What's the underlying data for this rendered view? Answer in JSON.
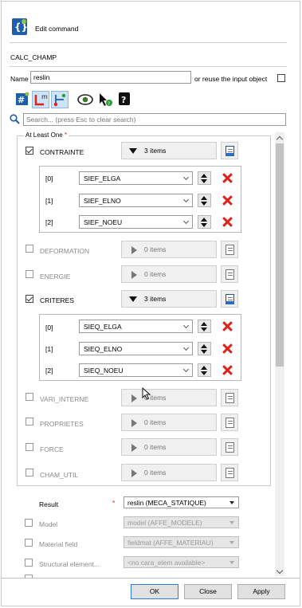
{
  "header": {
    "title": "Edit command",
    "command_name": "CALC_CHAMP"
  },
  "name_row": {
    "label": "Name",
    "value": "reslin",
    "reuse_label": "or reuse the input object"
  },
  "toolbar": {
    "icons": [
      "add-keyword-icon",
      "units-icon",
      "links-icon",
      "view-icon",
      "help-pointer-icon",
      "documentation-icon"
    ]
  },
  "search": {
    "placeholder": "Search... (press Esc to clear search)"
  },
  "group": {
    "title": "At Least One",
    "required_mark": "*"
  },
  "keywords": [
    {
      "name": "CONTRAINTE",
      "checked": true,
      "count": "3 items",
      "expanded": true,
      "items": [
        {
          "index": "[0]",
          "value": "SIEF_ELGA"
        },
        {
          "index": "[1]",
          "value": "SIEF_ELNO"
        },
        {
          "index": "[2]",
          "value": "SIEF_NOEU"
        }
      ]
    },
    {
      "name": "DEFORMATION",
      "checked": false,
      "count": "0 items"
    },
    {
      "name": "ENERGIE",
      "checked": false,
      "count": "0 items"
    },
    {
      "name": "CRITERES",
      "checked": true,
      "count": "3 items",
      "expanded": true,
      "items": [
        {
          "index": "[0]",
          "value": "SIEQ_ELGA"
        },
        {
          "index": "[1]",
          "value": "SIEQ_ELNO"
        },
        {
          "index": "[2]",
          "value": "SIEQ_NOEU"
        }
      ]
    },
    {
      "name": "VARI_INTERNE",
      "checked": false,
      "count": "0 items"
    },
    {
      "name": "PROPRIETES",
      "checked": false,
      "count": "0 items"
    },
    {
      "name": "FORCE",
      "checked": false,
      "count": "0 items"
    },
    {
      "name": "CHAM_UTIL",
      "checked": false,
      "count": "0 items"
    }
  ],
  "params": [
    {
      "label": "Result",
      "required": "*",
      "value": "reslin (MECA_STATIQUE)",
      "enabled": true
    },
    {
      "label": "Model",
      "value": "model (AFFE_MODELE)",
      "enabled": false
    },
    {
      "label": "Material field",
      "value": "fieldmat (AFFE_MATERIAU)",
      "enabled": false
    },
    {
      "label": "Structural element...",
      "value": "<no cara_elem available>",
      "enabled": false
    }
  ],
  "buttons": {
    "ok": "OK",
    "close": "Close",
    "apply": "Apply"
  },
  "colors": {
    "accent": "#2f7bd4",
    "delete": "#e0201a"
  }
}
